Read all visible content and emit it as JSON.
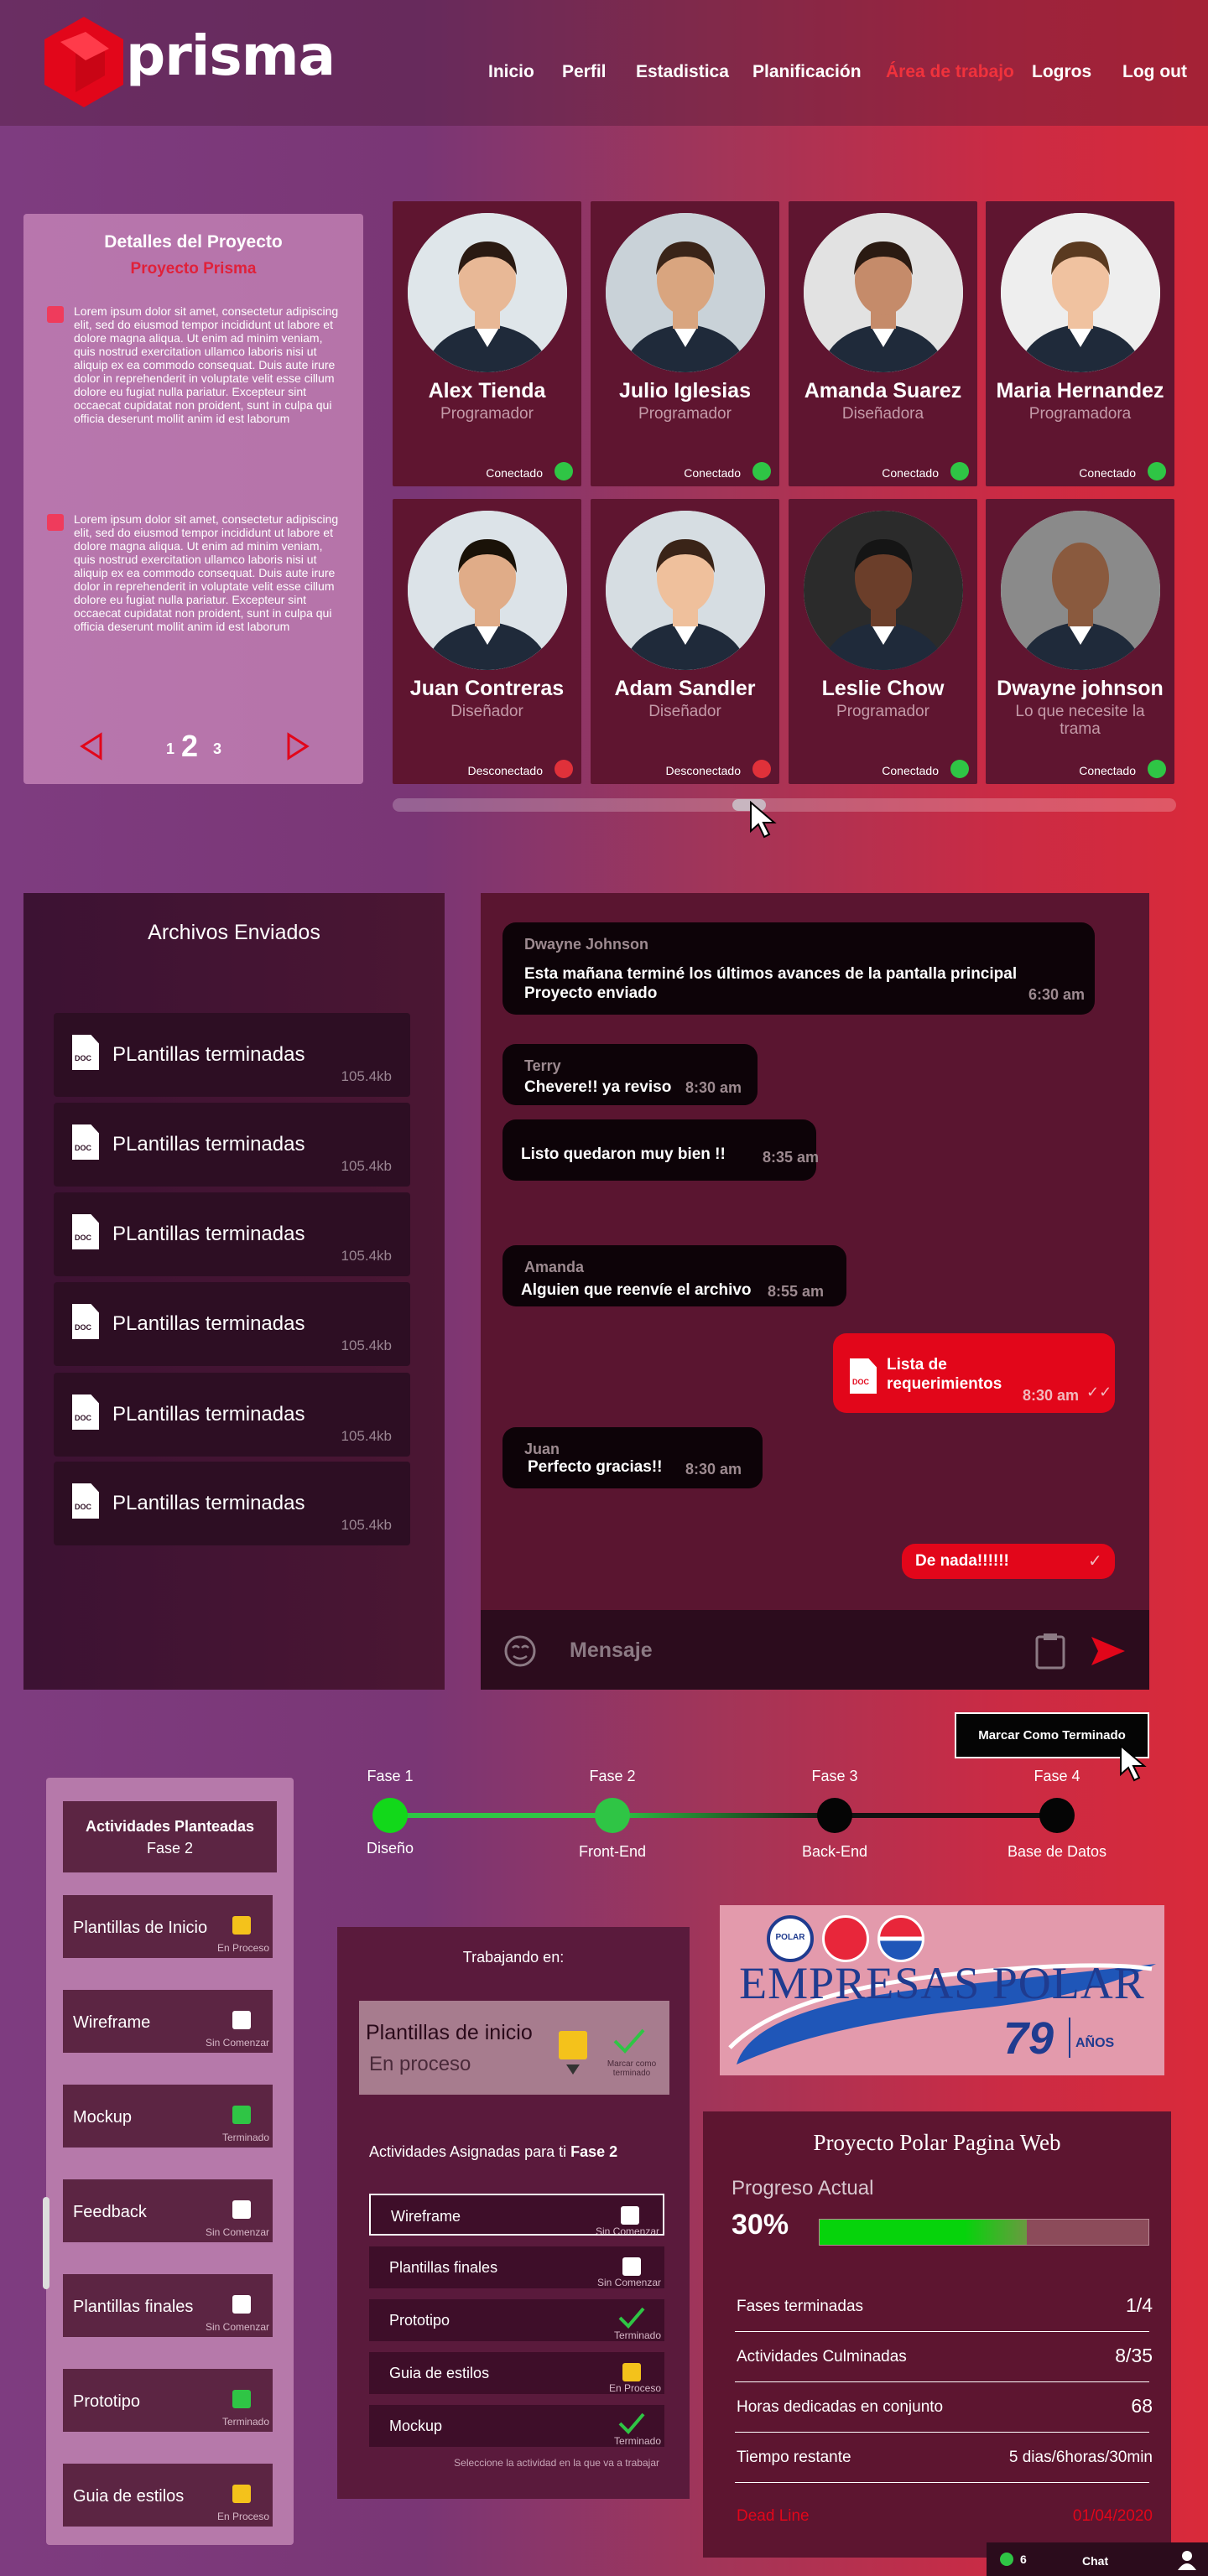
{
  "header": {
    "brand": "prisma",
    "nav": [
      "Inicio",
      "Perfil",
      "Estadistica",
      "Planificación",
      "Área de trabajo",
      "Logros",
      "Log out"
    ]
  },
  "details": {
    "title": "Detalles del Proyecto",
    "project": "Proyecto Prisma",
    "paragraphs": [
      "Lorem ipsum dolor sit amet, consectetur adipiscing elit, sed do eiusmod tempor incididunt ut labore et dolore magna aliqua. Ut enim ad minim veniam, quis nostrud exercitation ullamco laboris nisi ut aliquip ex ea commodo consequat. Duis aute irure dolor in reprehenderit in voluptate velit esse cillum dolore eu fugiat nulla pariatur. Excepteur sint occaecat cupidatat non proident, sunt in culpa qui officia deserunt mollit anim id est laborum",
      "Lorem ipsum dolor sit amet, consectetur adipiscing elit, sed do eiusmod tempor incididunt ut labore et dolore magna aliqua. Ut enim ad minim veniam, quis nostrud exercitation ullamco laboris nisi ut aliquip ex ea commodo consequat. Duis aute irure dolor in reprehenderit in voluptate velit esse cillum dolore eu fugiat nulla pariatur. Excepteur sint occaecat cupidatat non proident, sunt in culpa qui officia deserunt mollit anim id est laborum"
    ],
    "pages": [
      "1",
      "2",
      "3"
    ]
  },
  "team": [
    {
      "name": "Alex Tienda",
      "role": "Programador",
      "status": "Conectado",
      "online": true
    },
    {
      "name": "Julio Iglesias",
      "role": "Programador",
      "status": "Conectado",
      "online": true
    },
    {
      "name": "Amanda Suarez",
      "role": "Diseñadora",
      "status": "Conectado",
      "online": true
    },
    {
      "name": "Maria Hernandez",
      "role": "Programadora",
      "status": "Conectado",
      "online": true
    },
    {
      "name": "Juan Contreras",
      "role": "Diseñador",
      "status": "Desconectado",
      "online": false
    },
    {
      "name": "Adam Sandler",
      "role": "Diseñador",
      "status": "Desconectado",
      "online": false
    },
    {
      "name": "Leslie Chow",
      "role": "Programador",
      "status": "Conectado",
      "online": true
    },
    {
      "name": "Dwayne johnson",
      "role": "Lo que necesite la trama",
      "status": "Conectado",
      "online": true
    }
  ],
  "files": {
    "title": "Archivos Enviados",
    "doc_label": "DOC",
    "items": [
      {
        "name": "PLantillas terminadas",
        "size": "105.4kb"
      },
      {
        "name": "PLantillas terminadas",
        "size": "105.4kb"
      },
      {
        "name": "PLantillas terminadas",
        "size": "105.4kb"
      },
      {
        "name": "PLantillas terminadas",
        "size": "105.4kb"
      },
      {
        "name": "PLantillas terminadas",
        "size": "105.4kb"
      },
      {
        "name": "PLantillas terminadas",
        "size": "105.4kb"
      }
    ]
  },
  "chat": {
    "messages": [
      {
        "who": "Dwayne Johnson",
        "text": "Esta mañana terminé los últimos avances de la pantalla principal Proyecto enviado",
        "time": "6:30 am"
      },
      {
        "who": "Terry",
        "text": "Chevere!! ya reviso",
        "time": "8:30 am"
      },
      {
        "who": "",
        "text": "Listo quedaron muy bien !!",
        "time": "8:35 am"
      },
      {
        "who": "Amanda",
        "text": "Alguien que reenvíe el archivo",
        "time": "8:55 am"
      },
      {
        "who": "",
        "text": "Lista de requerimientos",
        "time": "8:30 am"
      },
      {
        "who": "Juan",
        "text": "Perfecto gracias!!",
        "time": "8:30 am"
      },
      {
        "who": "",
        "text": "De nada!!!!!!",
        "time": ""
      }
    ],
    "placeholder": "Mensaje"
  },
  "mark_button": "Marcar Como Terminado",
  "activities": {
    "title": "Actividades Planteadas",
    "phase": "Fase 2",
    "items": [
      {
        "label": "Plantillas de Inicio",
        "status": "En Proceso",
        "color": "#f4c21b"
      },
      {
        "label": "Wireframe",
        "status": "Sin Comenzar",
        "color": "#ffffff"
      },
      {
        "label": "Mockup",
        "status": "Terminado",
        "color": "#2fc545"
      },
      {
        "label": "Feedback",
        "status": "Sin Comenzar",
        "color": "#ffffff"
      },
      {
        "label": "Plantillas finales",
        "status": "Sin Comenzar",
        "color": "#ffffff"
      },
      {
        "label": "Prototipo",
        "status": "Terminado",
        "color": "#2fc545"
      },
      {
        "label": "Guia de estilos",
        "status": "En Proceso",
        "color": "#f4c21b"
      }
    ]
  },
  "phases": [
    {
      "top": "Fase 1",
      "bottom": "Diseño"
    },
    {
      "top": "Fase 2",
      "bottom": "Front-End"
    },
    {
      "top": "Fase 3",
      "bottom": "Back-End"
    },
    {
      "top": "Fase 4",
      "bottom": "Base de Datos"
    }
  ],
  "working": {
    "title": "Trabajando en:",
    "current": "Plantillas de inicio",
    "current_status": "En proceso",
    "mark_done": "Marcar como terminado",
    "assigned_prefix": "Actividades Asignadas para ti ",
    "assigned_phase": "Fase 2",
    "tasks": [
      {
        "label": "Wireframe",
        "status": "Sin Comenzar",
        "state": "empty"
      },
      {
        "label": "Plantillas finales",
        "status": "Sin Comenzar",
        "state": "empty"
      },
      {
        "label": "Prototipo",
        "status": "Terminado",
        "state": "done"
      },
      {
        "label": "Guia de estilos",
        "status": "En Proceso",
        "state": "progress"
      },
      {
        "label": "Mockup",
        "status": "Terminado",
        "state": "done"
      }
    ],
    "hint": "Seleccione la actividad en la que va a trabajar"
  },
  "sponsor": {
    "brand": "EMPRESAS POLAR",
    "anniversary": "79",
    "years": "AÑOS",
    "logo_word": "POLAR"
  },
  "progress": {
    "title": "Proyecto Polar Pagina Web",
    "label": "Progreso Actual",
    "percent": "30%",
    "value": 0.3,
    "stats": [
      {
        "label": "Fases terminadas",
        "value": "1/4"
      },
      {
        "label": "Actividades Culminadas",
        "value": "8/35"
      },
      {
        "label": "Horas  dedicadas en conjunto",
        "value": "68"
      },
      {
        "label": "Tiempo restante",
        "value": "5 dias/6horas/30min"
      }
    ],
    "deadline_label": "Dead Line",
    "deadline": "01/04/2020"
  },
  "chat_tab": {
    "online": "6",
    "label": "Chat"
  },
  "colors": {
    "accent": "#e2061a",
    "online": "#2fc545",
    "offline": "#e0313a",
    "progress": "#06d30b"
  }
}
